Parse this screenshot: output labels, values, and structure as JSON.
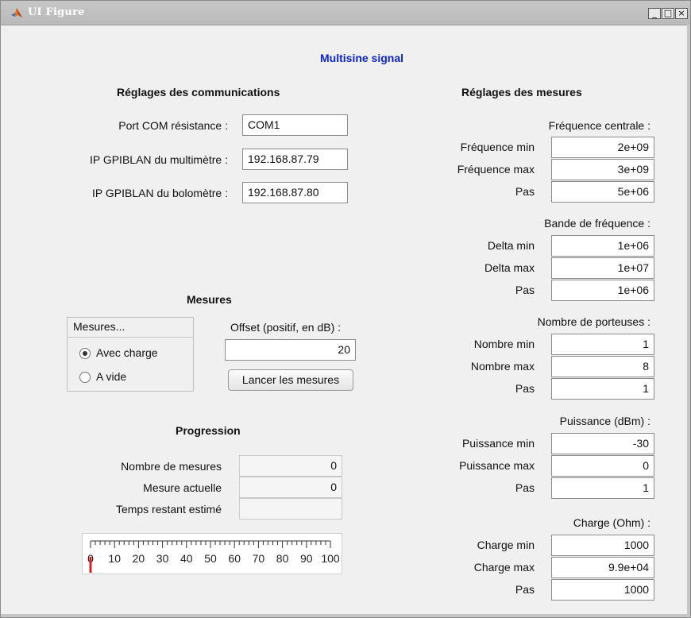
{
  "window": {
    "title": "UI Figure",
    "controls": {
      "minimize": "_",
      "maximize": "□",
      "close": "×"
    }
  },
  "header": {
    "title": "Multisine signal",
    "title_color": "#0a24c8"
  },
  "comms": {
    "title": "Réglages des communications",
    "rows": [
      {
        "label": "Port COM résistance :",
        "value": "COM1"
      },
      {
        "label": "IP GPIBLAN du multimètre :",
        "value": "192.168.87.79"
      },
      {
        "label": "IP GPIBLAN du bolomètre :",
        "value": "192.168.87.80"
      }
    ]
  },
  "mesures": {
    "title": "Mesures",
    "group_title": "Mesures...",
    "options": [
      {
        "label": "Avec charge",
        "selected": true
      },
      {
        "label": "A vide",
        "selected": false
      }
    ],
    "offset_label": "Offset (positif, en dB) :",
    "offset_value": "20",
    "launch_button": "Lancer les mesures"
  },
  "progression": {
    "title": "Progression",
    "rows": [
      {
        "label": "Nombre de mesures",
        "value": "0"
      },
      {
        "label": "Mesure actuelle",
        "value": "0"
      },
      {
        "label": "Temps restant estimé",
        "value": ""
      }
    ],
    "gauge": {
      "ticks": [
        "0",
        "10",
        "20",
        "30",
        "40",
        "50",
        "60",
        "70",
        "80",
        "90",
        "100"
      ],
      "value": 0,
      "needle_color": "#d42020"
    }
  },
  "settings": {
    "title": "Réglages des mesures",
    "groups": [
      {
        "title": "Fréquence centrale :",
        "rows": [
          {
            "label": "Fréquence min",
            "value": "2e+09"
          },
          {
            "label": "Fréquence max",
            "value": "3e+09"
          },
          {
            "label": "Pas",
            "value": "5e+06"
          }
        ]
      },
      {
        "title": "Bande de fréquence :",
        "rows": [
          {
            "label": "Delta min",
            "value": "1e+06"
          },
          {
            "label": "Delta max",
            "value": "1e+07"
          },
          {
            "label": "Pas",
            "value": "1e+06"
          }
        ]
      },
      {
        "title": "Nombre de porteuses :",
        "rows": [
          {
            "label": "Nombre min",
            "value": "1"
          },
          {
            "label": "Nombre max",
            "value": "8"
          },
          {
            "label": "Pas",
            "value": "1"
          }
        ]
      },
      {
        "title": "Puissance (dBm) :",
        "rows": [
          {
            "label": "Puissance min",
            "value": "-30"
          },
          {
            "label": "Puissance max",
            "value": "0"
          },
          {
            "label": "Pas",
            "value": "1"
          }
        ]
      },
      {
        "title": "Charge (Ohm) :",
        "rows": [
          {
            "label": "Charge min",
            "value": "1000"
          },
          {
            "label": "Charge max",
            "value": "9.9e+04"
          },
          {
            "label": "Pas",
            "value": "1000"
          }
        ]
      }
    ]
  }
}
